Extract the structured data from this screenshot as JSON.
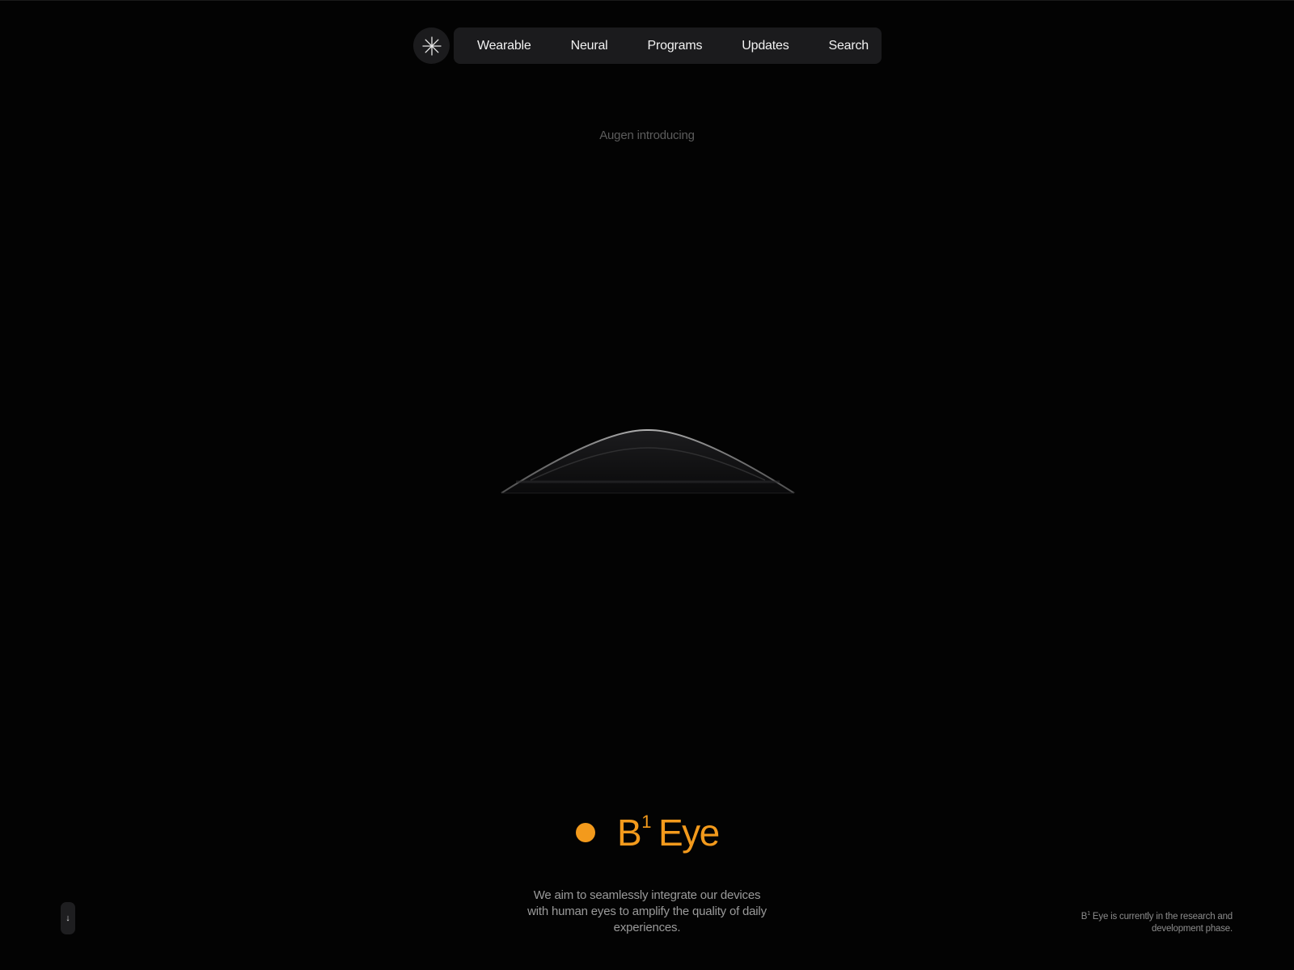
{
  "nav": {
    "logo_icon": "asterisk-spark-icon",
    "items": [
      {
        "label": "Wearable"
      },
      {
        "label": "Neural"
      },
      {
        "label": "Programs"
      },
      {
        "label": "Updates"
      },
      {
        "label": "Search"
      }
    ]
  },
  "hero": {
    "intro": "Augen introducing",
    "lens_graphic": "contact-lens-illustration"
  },
  "product": {
    "name_prefix": "B",
    "name_superscript": "1",
    "name_suffix": "Eye",
    "accent_color": "#f39a1c"
  },
  "description": "We aim to seamlessly integrate our devices with human eyes to amplify the quality of daily experiences.",
  "scroll_button": {
    "icon": "arrow-down-icon",
    "glyph": "↓"
  },
  "status_note": {
    "prefix": "B",
    "superscript": "1",
    "text": " Eye is currently in the research and development phase."
  }
}
